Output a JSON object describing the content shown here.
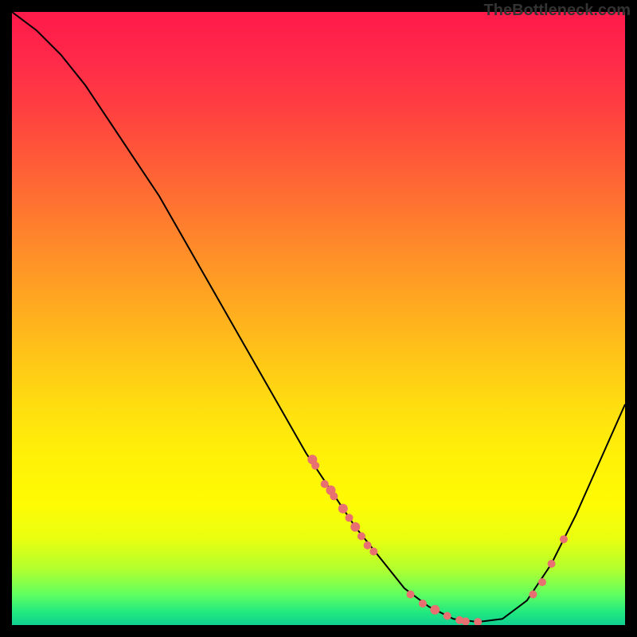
{
  "watermark": "TheBottleneck.com",
  "chart_data": {
    "type": "line",
    "title": "",
    "xlabel": "",
    "ylabel": "",
    "xlim": [
      0,
      100
    ],
    "ylim": [
      0,
      100
    ],
    "curve": [
      {
        "x": 0,
        "y": 100
      },
      {
        "x": 4,
        "y": 97
      },
      {
        "x": 8,
        "y": 93
      },
      {
        "x": 12,
        "y": 88
      },
      {
        "x": 16,
        "y": 82
      },
      {
        "x": 20,
        "y": 76
      },
      {
        "x": 24,
        "y": 70
      },
      {
        "x": 28,
        "y": 63
      },
      {
        "x": 32,
        "y": 56
      },
      {
        "x": 36,
        "y": 49
      },
      {
        "x": 40,
        "y": 42
      },
      {
        "x": 44,
        "y": 35
      },
      {
        "x": 48,
        "y": 28
      },
      {
        "x": 52,
        "y": 22
      },
      {
        "x": 56,
        "y": 16
      },
      {
        "x": 60,
        "y": 11
      },
      {
        "x": 64,
        "y": 6
      },
      {
        "x": 68,
        "y": 3
      },
      {
        "x": 72,
        "y": 1
      },
      {
        "x": 76,
        "y": 0.5
      },
      {
        "x": 80,
        "y": 1
      },
      {
        "x": 84,
        "y": 4
      },
      {
        "x": 88,
        "y": 10
      },
      {
        "x": 92,
        "y": 18
      },
      {
        "x": 96,
        "y": 27
      },
      {
        "x": 100,
        "y": 36
      }
    ],
    "dots": [
      {
        "x": 49,
        "y": 27,
        "r": 6
      },
      {
        "x": 49.5,
        "y": 26,
        "r": 5
      },
      {
        "x": 51,
        "y": 23,
        "r": 5
      },
      {
        "x": 52,
        "y": 22,
        "r": 6
      },
      {
        "x": 52.5,
        "y": 21,
        "r": 5
      },
      {
        "x": 54,
        "y": 19,
        "r": 6
      },
      {
        "x": 55,
        "y": 17.5,
        "r": 5
      },
      {
        "x": 56,
        "y": 16,
        "r": 6
      },
      {
        "x": 57,
        "y": 14.5,
        "r": 5
      },
      {
        "x": 58,
        "y": 13,
        "r": 5
      },
      {
        "x": 59,
        "y": 12,
        "r": 5
      },
      {
        "x": 65,
        "y": 5,
        "r": 5
      },
      {
        "x": 67,
        "y": 3.5,
        "r": 5
      },
      {
        "x": 69,
        "y": 2.5,
        "r": 6
      },
      {
        "x": 71,
        "y": 1.5,
        "r": 5
      },
      {
        "x": 73,
        "y": 0.8,
        "r": 5
      },
      {
        "x": 74,
        "y": 0.6,
        "r": 5
      },
      {
        "x": 76,
        "y": 0.5,
        "r": 5
      },
      {
        "x": 85,
        "y": 5,
        "r": 5
      },
      {
        "x": 86.5,
        "y": 7,
        "r": 5
      },
      {
        "x": 88,
        "y": 10,
        "r": 5
      },
      {
        "x": 90,
        "y": 14,
        "r": 5
      }
    ],
    "dot_color": "#e87070",
    "curve_color": "#000000"
  }
}
